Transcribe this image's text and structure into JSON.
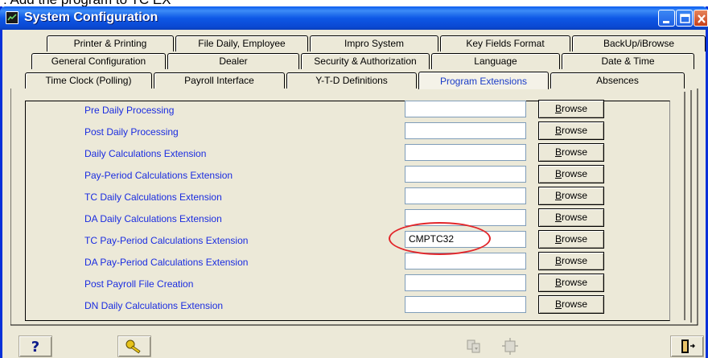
{
  "caption": ": Add the program to TC EX",
  "window": {
    "title": "System Configuration"
  },
  "tabs": {
    "row1": [
      {
        "label": "Printer & Printing"
      },
      {
        "label": "File Daily, Employee"
      },
      {
        "label": "Impro System"
      },
      {
        "label": "Key Fields Format"
      },
      {
        "label": "BackUp/iBrowse"
      }
    ],
    "row2": [
      {
        "label": "General Configuration"
      },
      {
        "label": "Dealer"
      },
      {
        "label": "Security & Authorization"
      },
      {
        "label": "Language"
      },
      {
        "label": "Date & Time"
      }
    ],
    "row3": [
      {
        "label": "Time Clock (Polling)"
      },
      {
        "label": "Payroll Interface"
      },
      {
        "label": "Y-T-D Definitions"
      },
      {
        "label": "Program Extensions"
      },
      {
        "label": "Absences"
      }
    ],
    "active": "Program Extensions"
  },
  "extensions": [
    {
      "label": "Pre  Daily Processing",
      "value": "",
      "button": "Browse"
    },
    {
      "label": "Post Daily Processing",
      "value": "",
      "button": "Browse"
    },
    {
      "label": "Daily Calculations Extension",
      "value": "",
      "button": "Browse"
    },
    {
      "label": "Pay-Period Calculations Extension",
      "value": "",
      "button": "Browse"
    },
    {
      "label": "TC Daily Calculations Extension",
      "value": "",
      "button": "Browse"
    },
    {
      "label": "DA Daily Calculations Extension",
      "value": "",
      "button": "Browse"
    },
    {
      "label": "TC Pay-Period Calculations Extension",
      "value": "CMPTC32",
      "button": "Browse"
    },
    {
      "label": "DA Pay-Period Calculations Extension",
      "value": "",
      "button": "Browse"
    },
    {
      "label": "Post Payroll File Creation",
      "value": "",
      "button": "Browse"
    },
    {
      "label": "DN Daily Calculations Extension",
      "value": "",
      "button": "Browse"
    }
  ],
  "toolbar": {
    "help_icon": "question-mark-icon",
    "key_icon": "key-icon",
    "save_icon": "save-disabled-icon",
    "apply_icon": "apply-disabled-icon",
    "exit_icon": "exit-door-icon"
  },
  "colors": {
    "label_blue": "#1a2ce0",
    "highlight_red": "#e2262a",
    "titlebar_blue": "#0a5cf0"
  }
}
